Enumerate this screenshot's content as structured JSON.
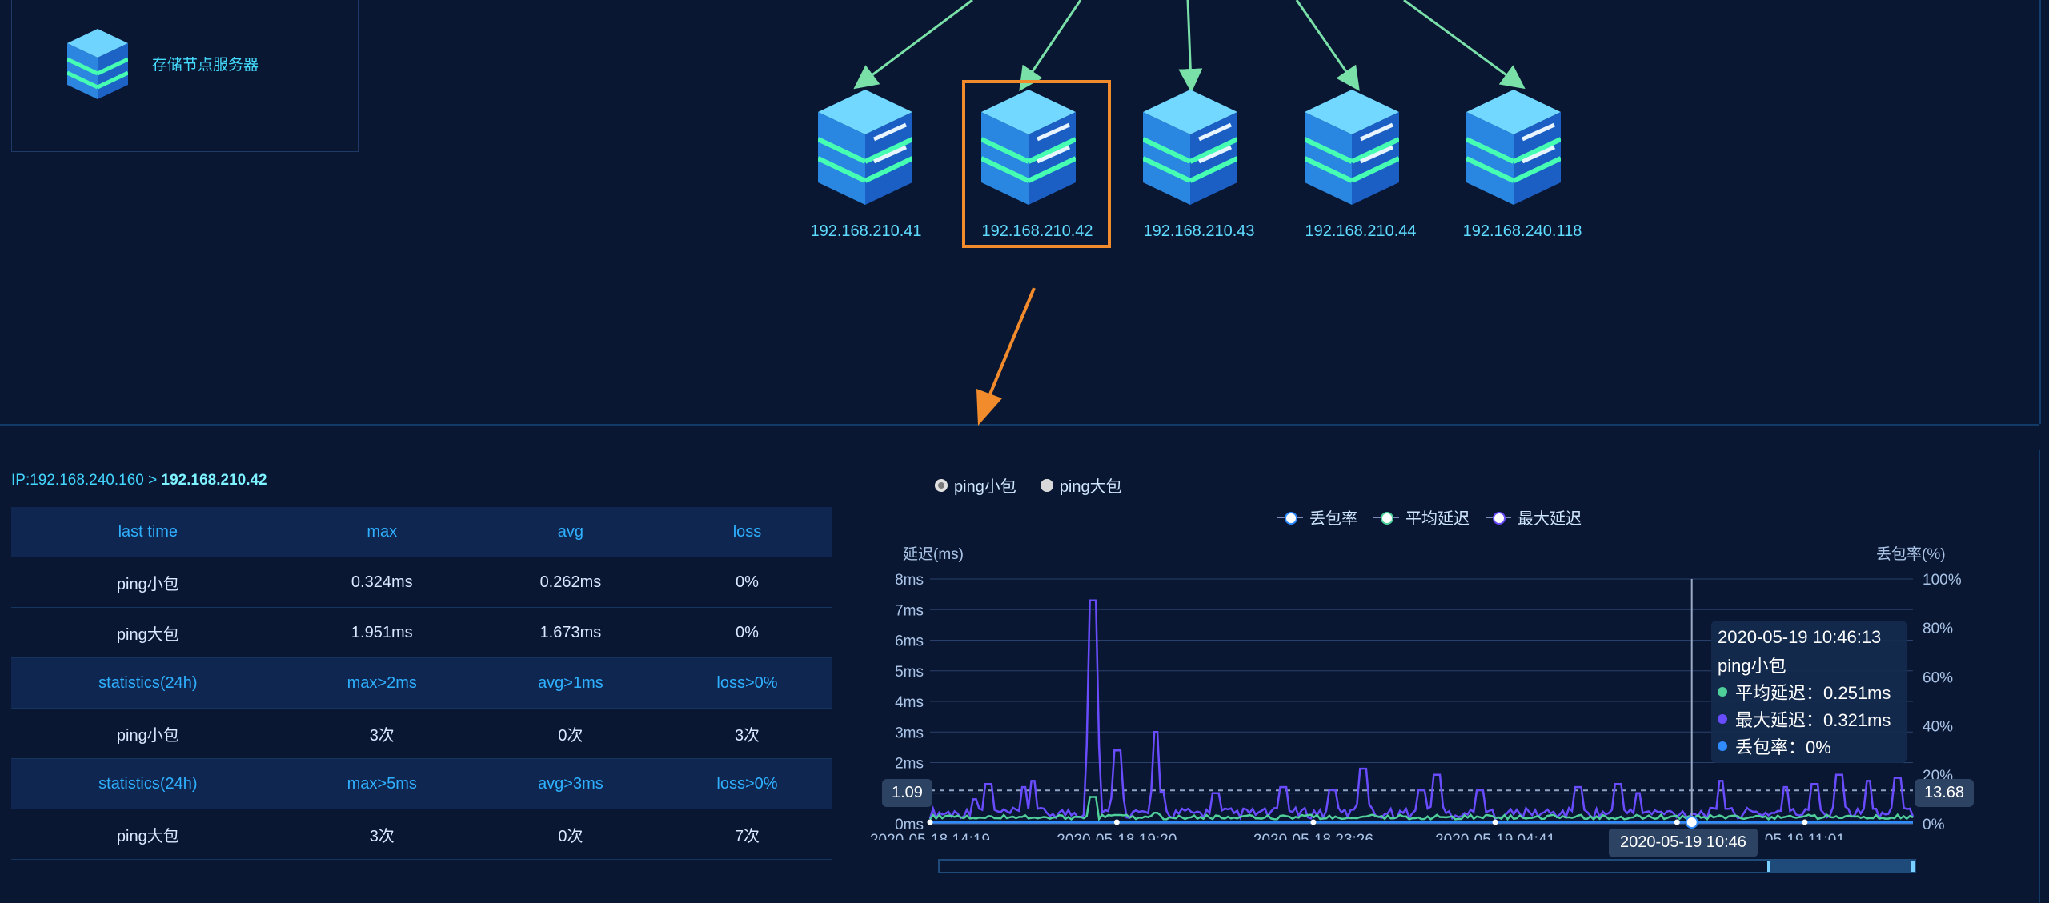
{
  "topology": {
    "legend_items": [
      {
        "label": "存储节点服务器",
        "icon": "storage-server-icon"
      }
    ],
    "nodes": [
      {
        "ip": "192.168.210.41",
        "selected": false
      },
      {
        "ip": "192.168.210.42",
        "selected": true
      },
      {
        "ip": "192.168.210.43",
        "selected": false
      },
      {
        "ip": "192.168.210.44",
        "selected": false
      },
      {
        "ip": "192.168.240.118",
        "selected": false
      }
    ],
    "arrow_color": "#79e0a8",
    "select_color": "#f18b2b"
  },
  "detail": {
    "ip_prefix": "IP:192.168.240.160 > ",
    "ip_target": "192.168.210.42",
    "table": {
      "rows": [
        {
          "type": "header",
          "cells": [
            "last time",
            "max",
            "avg",
            "loss"
          ]
        },
        {
          "type": "row",
          "cells": [
            "ping小包",
            "0.324ms",
            "0.262ms",
            "0%"
          ]
        },
        {
          "type": "row",
          "cells": [
            "ping大包",
            "1.951ms",
            "1.673ms",
            "0%"
          ]
        },
        {
          "type": "header",
          "cells": [
            "statistics(24h)",
            "max>2ms",
            "avg>1ms",
            "loss>0%"
          ]
        },
        {
          "type": "row",
          "cells": [
            "ping小包",
            "3次",
            "0次",
            "3次"
          ]
        },
        {
          "type": "header",
          "cells": [
            "statistics(24h)",
            "max>5ms",
            "avg>3ms",
            "loss>0%"
          ]
        },
        {
          "type": "row",
          "cells": [
            "ping大包",
            "3次",
            "0次",
            "7次"
          ]
        }
      ]
    }
  },
  "chart": {
    "radios": [
      {
        "label": "ping小包",
        "selected": true
      },
      {
        "label": "ping大包",
        "selected": false
      }
    ],
    "legend": [
      {
        "label": "丢包率",
        "color": "#2f8bff"
      },
      {
        "label": "平均延迟",
        "color": "#4fd09a"
      },
      {
        "label": "最大延迟",
        "color": "#6a4cff"
      }
    ],
    "left_axis_title": "延迟(ms)",
    "right_axis_title": "丢包率(%)",
    "left_badge": "1.09",
    "right_badge": "13.68",
    "crosshair_time": "2020-05-19 10:46",
    "tooltip": {
      "time": "2020-05-19 10:46:13",
      "name": "ping小包",
      "items": [
        {
          "label": "平均延迟：0.251ms",
          "color": "#4fd09a"
        },
        {
          "label": "最大延迟：0.321ms",
          "color": "#6a4cff"
        },
        {
          "label": "丢包率：0%",
          "color": "#2f8bff"
        }
      ]
    }
  },
  "chart_data": {
    "type": "line",
    "y_left": {
      "title": "延迟(ms)",
      "ticks": [
        "0ms",
        "1ms",
        "2ms",
        "3ms",
        "4ms",
        "5ms",
        "6ms",
        "7ms",
        "8ms"
      ],
      "ylim": [
        0,
        8
      ]
    },
    "y_right": {
      "title": "丢包率(%)",
      "ticks": [
        "0%",
        "20%",
        "40%",
        "60%",
        "80%",
        "100%"
      ],
      "ylim": [
        0,
        100
      ]
    },
    "x_ticks": [
      "2020-05-18 14:19",
      "2020-05-18 19:20",
      "2020-05-18 23:26",
      "2020-05-19 04:41",
      "2020-05-19 10:46",
      "2020-05-19 11:01"
    ],
    "x_tick_labels_visible": [
      "2020-05-18 14:19",
      "2020-05-18 19:20",
      "2020-05-18 23:26",
      "2020-05-19 04:41",
      "2020-05",
      "05-19 11:01"
    ],
    "series": [
      {
        "name": "最大延迟",
        "color": "#6a4cff",
        "spikes": [
          {
            "x": 0.045,
            "y": 0.8
          },
          {
            "x": 0.06,
            "y": 1.3
          },
          {
            "x": 0.095,
            "y": 1.2
          },
          {
            "x": 0.105,
            "y": 1.4
          },
          {
            "x": 0.165,
            "y": 7.3
          },
          {
            "x": 0.19,
            "y": 2.4
          },
          {
            "x": 0.23,
            "y": 3.0
          },
          {
            "x": 0.29,
            "y": 1.0
          },
          {
            "x": 0.36,
            "y": 1.2
          },
          {
            "x": 0.41,
            "y": 1.1
          },
          {
            "x": 0.44,
            "y": 1.8
          },
          {
            "x": 0.5,
            "y": 1.1
          },
          {
            "x": 0.515,
            "y": 1.6
          },
          {
            "x": 0.56,
            "y": 1.1
          },
          {
            "x": 0.66,
            "y": 1.2
          },
          {
            "x": 0.7,
            "y": 1.3
          },
          {
            "x": 0.72,
            "y": 1.0
          },
          {
            "x": 0.805,
            "y": 1.4
          },
          {
            "x": 0.87,
            "y": 1.2
          },
          {
            "x": 0.9,
            "y": 1.3
          },
          {
            "x": 0.925,
            "y": 1.6
          },
          {
            "x": 0.955,
            "y": 1.4
          },
          {
            "x": 0.985,
            "y": 1.5
          }
        ],
        "baseline": 0.35
      },
      {
        "name": "平均延迟",
        "color": "#4fd09a",
        "baseline": 0.22
      },
      {
        "name": "丢包率",
        "color": "#2f8bff",
        "baseline": 0.0
      }
    ],
    "reference_line": 1.09,
    "crosshair_x": 0.775
  }
}
